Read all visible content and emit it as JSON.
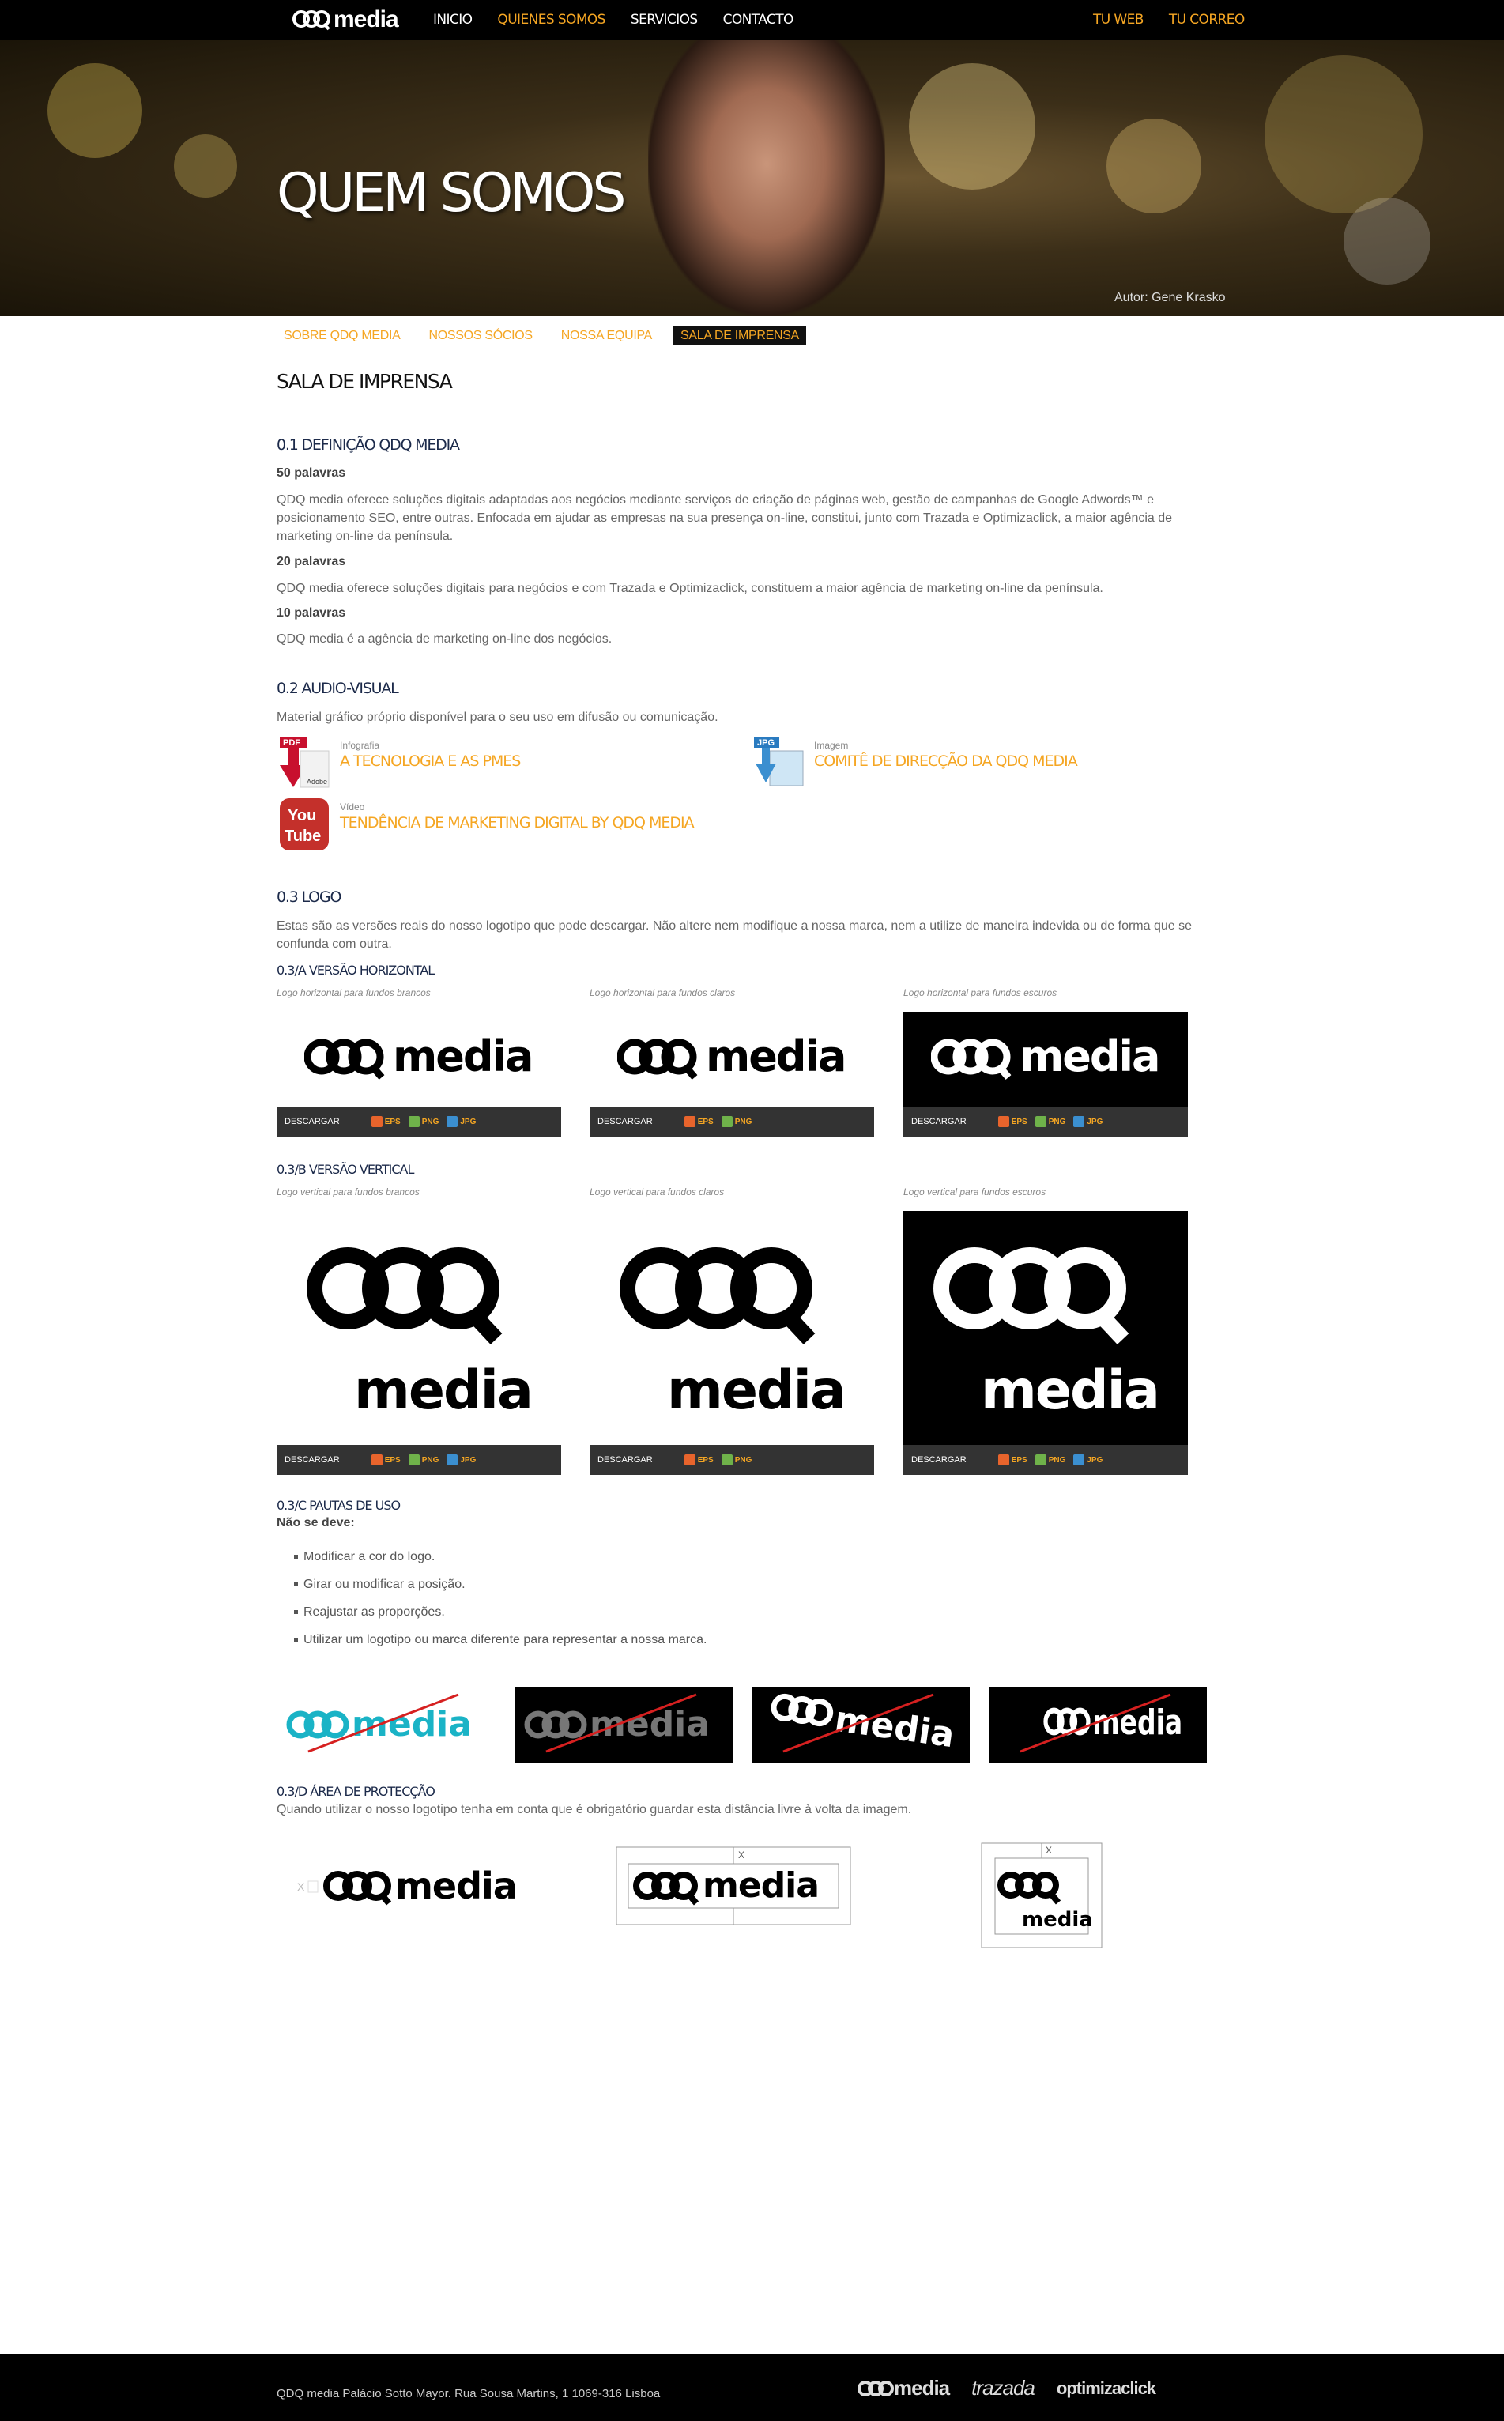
{
  "nav": {
    "brand": "media",
    "items": [
      "INICIO",
      "QUIENES SOMOS",
      "SERVICIOS",
      "CONTACTO"
    ],
    "active_index": 1,
    "right": [
      "TU WEB",
      "TU CORREO"
    ]
  },
  "hero": {
    "title": "QUEM SOMOS",
    "credit": "Autor: Gene Krasko"
  },
  "subnav": {
    "items": [
      "SOBRE QDQ MEDIA",
      "NOSSOS SÓCIOS",
      "NOSSA EQUIPA",
      "SALA DE IMPRENSA"
    ],
    "active_index": 3
  },
  "page_title": "SALA DE IMPRENSA",
  "s01": {
    "title": "0.1 DEFINIÇÃO QDQ MEDIA",
    "l50": "50 palavras",
    "t50": "QDQ media oferece soluções digitais adaptadas aos negócios mediante serviços de criação de páginas web, gestão de campanhas de Google Adwords™ e posicionamento SEO, entre outras. Enfocada em ajudar as empresas na sua presença on-line, constitui, junto com Trazada e Optimizaclick, a maior agência de marketing on-line da península.",
    "l20": "20 palavras",
    "t20": "QDQ media oferece soluções digitais para negócios e com Trazada e Optimizaclick, constituem a maior agência de marketing on-line da península.",
    "l10": "10 palavras",
    "t10": "QDQ media é a agência de marketing on-line dos negócios."
  },
  "s02": {
    "title": "0.2 AUDIO-VISUAL",
    "desc": "Material gráfico próprio disponível para o seu uso em difusão ou comunicação.",
    "items": [
      {
        "kind": "Infografia",
        "title": "A TECNOLOGIA E AS PMES",
        "icon": "pdf-icon"
      },
      {
        "kind": "Imagem",
        "title": "COMITÊ DE DIRECÇÃO DA QDQ MEDIA",
        "icon": "jpg-icon"
      },
      {
        "kind": "Vídeo",
        "title": "TENDÊNCIA DE MARKETING DIGITAL BY QDQ MEDIA",
        "icon": "youtube-icon"
      }
    ],
    "pdf_label": "PDF",
    "adobe_label": "Adobe",
    "jpg_label": "JPG",
    "yt_you": "You",
    "yt_tube": "Tube"
  },
  "s03": {
    "title": "0.3 LOGO",
    "desc": "Estas são as versões reais do nosso logotipo que pode descargar. Não altere nem modifique a nossa marca, nem a utilize de maneira indevida ou de forma que se confunda com outra.",
    "a_title": "0.3/A VERSÃO HORIZONTAL",
    "a_caps": [
      "Logo horizontal para fundos brancos",
      "Logo horizontal para fundos claros",
      "Logo horizontal para fundos escuros"
    ],
    "b_title": "0.3/B VERSÃO VERTICAL",
    "b_caps": [
      "Logo vertical para fundos brancos",
      "Logo vertical para fundos claros",
      "Logo vertical para fundos escuros"
    ],
    "download": "DESCARGAR",
    "formats": [
      "EPS",
      "PNG",
      "JPG"
    ],
    "wordmark": "media",
    "c_title": "0.3/C PAUTAS DE USO",
    "c_lead": "Não se deve:",
    "c_rules": [
      "Modificar a cor do logo.",
      "Girar ou modificar a posição.",
      "Reajustar as proporções.",
      "Utilizar um logotipo ou marca diferente para representar a nossa marca."
    ],
    "d_title": "0.3/D ÁREA DE PROTECÇÃO",
    "d_desc": "Quando utilizar o nosso logotipo tenha em conta que é obrigatório guardar esta distância livre à volta da imagem.",
    "x_mark": "X"
  },
  "footer": {
    "address": "QDQ media Palácio Sotto Mayor. Rua Sousa Martins, 1 1069-316 Lisboa",
    "brands": [
      "media",
      "trazada",
      "optimizaclick"
    ]
  },
  "colors": {
    "accent": "#f5a623",
    "dark": "#000000",
    "bar": "#333333",
    "teal": "#1ab3c6",
    "strike": "#d62020"
  }
}
